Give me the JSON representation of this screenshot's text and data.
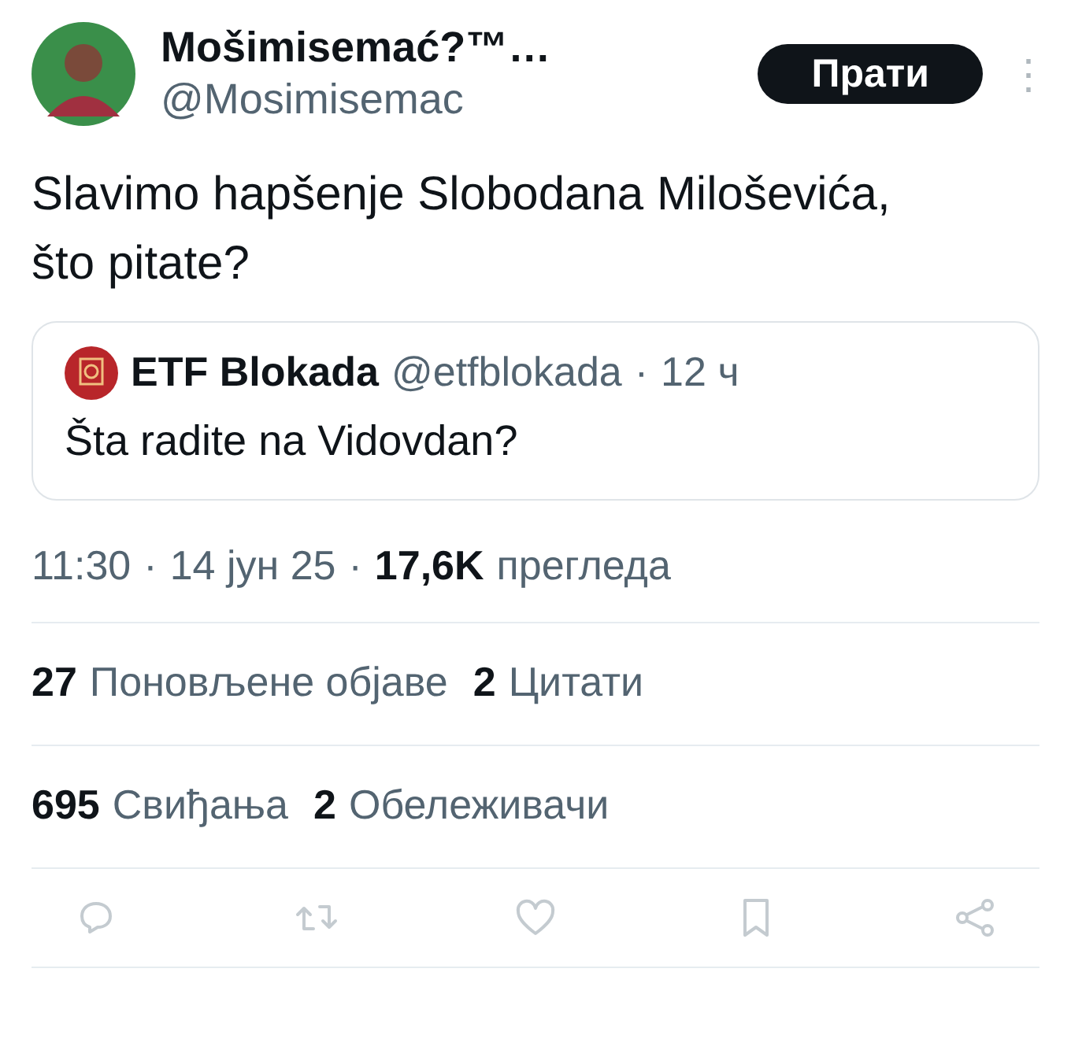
{
  "author": {
    "name": "Mošimisemać?™…",
    "handle": "@Mosimisemac",
    "follow_button": "Прати",
    "more": "⋮"
  },
  "text": "Slavimo hapšenje Slobodana Miloševića, što pitate?",
  "quote": {
    "name": "ETF Blokada",
    "handle": "@etfblokada",
    "separator": "·",
    "time": "12 ч",
    "text": "Šta radite na Vidovdan?"
  },
  "meta": {
    "time": "11:30",
    "sep1": "·",
    "date": "14 јун 25",
    "sep2": "·",
    "views": "17,6K",
    "views_label": "прегледа"
  },
  "stat_rows": [
    [
      {
        "count": "27",
        "label": "Поновљене објаве"
      },
      {
        "count": "2",
        "label": "Цитати"
      }
    ],
    [
      {
        "count": "695",
        "label": "Свиђања"
      },
      {
        "count": "2",
        "label": "Обележивачи"
      }
    ]
  ],
  "actions": [
    {
      "kind": "reply"
    },
    {
      "kind": "repost"
    },
    {
      "kind": "like"
    },
    {
      "kind": "bookmark"
    },
    {
      "kind": "share"
    }
  ]
}
